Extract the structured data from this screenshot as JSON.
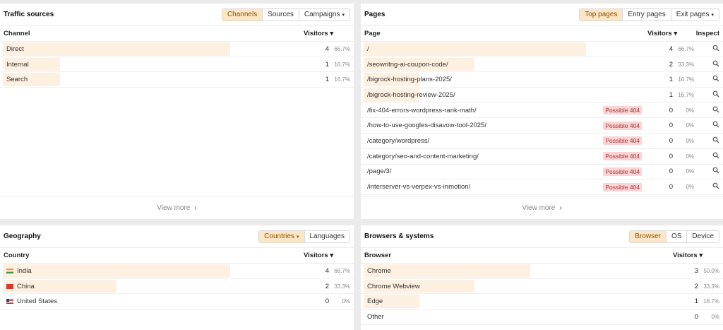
{
  "traffic": {
    "title": "Traffic sources",
    "tabs": [
      "Channels",
      "Sources",
      "Campaigns"
    ],
    "col_name": "Channel",
    "col_visitors": "Visitors",
    "rows": [
      {
        "name": "Direct",
        "visitors": "4",
        "pct": "66.7%",
        "share": 0.667
      },
      {
        "name": "Internal",
        "visitors": "1",
        "pct": "16.7%",
        "share": 0.167
      },
      {
        "name": "Search",
        "visitors": "1",
        "pct": "16.7%",
        "share": 0.167
      }
    ],
    "view_more": "View more"
  },
  "pages": {
    "title": "Pages",
    "tabs": [
      "Top pages",
      "Entry pages",
      "Exit pages"
    ],
    "col_name": "Page",
    "col_visitors": "Visitors",
    "col_inspect": "Inspect",
    "badge_text": "Possible 404",
    "rows": [
      {
        "name": "/",
        "visitors": "4",
        "pct": "66.7%",
        "share": 0.667,
        "badge": false
      },
      {
        "name": "/seowritng-ai-coupon-code/",
        "visitors": "2",
        "pct": "33.3%",
        "share": 0.333,
        "badge": false
      },
      {
        "name": "/bigrock-hosting-plans-2025/",
        "visitors": "1",
        "pct": "16.7%",
        "share": 0.167,
        "badge": false
      },
      {
        "name": "/bigrock-hosting-review-2025/",
        "visitors": "1",
        "pct": "16.7%",
        "share": 0.167,
        "badge": false
      },
      {
        "name": "/fix-404-errors-wordpress-rank-math/",
        "visitors": "0",
        "pct": "0%",
        "share": 0,
        "badge": true
      },
      {
        "name": "/how-to-use-googles-disavow-tool-2025/",
        "visitors": "0",
        "pct": "0%",
        "share": 0,
        "badge": true
      },
      {
        "name": "/category/wordpress/",
        "visitors": "0",
        "pct": "0%",
        "share": 0,
        "badge": true
      },
      {
        "name": "/category/seo-and-content-marketing/",
        "visitors": "0",
        "pct": "0%",
        "share": 0,
        "badge": true
      },
      {
        "name": "/page/3/",
        "visitors": "0",
        "pct": "0%",
        "share": 0,
        "badge": true
      },
      {
        "name": "/interserver-vs-verpex-vs-inmotion/",
        "visitors": "0",
        "pct": "0%",
        "share": 0,
        "badge": true
      }
    ],
    "view_more": "View more"
  },
  "geo": {
    "title": "Geography",
    "tabs": [
      "Countries",
      "Languages"
    ],
    "col_name": "Country",
    "col_visitors": "Visitors",
    "rows": [
      {
        "name": "India",
        "flag": "in",
        "visitors": "4",
        "pct": "66.7%",
        "share": 0.667
      },
      {
        "name": "China",
        "flag": "cn",
        "visitors": "2",
        "pct": "33.3%",
        "share": 0.333
      },
      {
        "name": "United States",
        "flag": "us",
        "visitors": "0",
        "pct": "0%",
        "share": 0
      }
    ]
  },
  "browsers": {
    "title": "Browsers & systems",
    "tabs": [
      "Browser",
      "OS",
      "Device"
    ],
    "col_name": "Browser",
    "col_visitors": "Visitors",
    "rows": [
      {
        "name": "Chrome",
        "visitors": "3",
        "pct": "50.0%",
        "share": 0.5
      },
      {
        "name": "Chrome Webview",
        "visitors": "2",
        "pct": "33.3%",
        "share": 0.333
      },
      {
        "name": "Edge",
        "visitors": "1",
        "pct": "16.7%",
        "share": 0.167
      },
      {
        "name": "Other",
        "visitors": "0",
        "pct": "0%",
        "share": 0
      }
    ]
  },
  "colors": {
    "accent_bg": "#fde6c6",
    "bar": "#fdf0e0",
    "badge_bg": "#fbd5d5"
  },
  "icons": {
    "sort": "caret-down-icon",
    "inspect": "search-icon",
    "more": "chevron-right-icon"
  }
}
